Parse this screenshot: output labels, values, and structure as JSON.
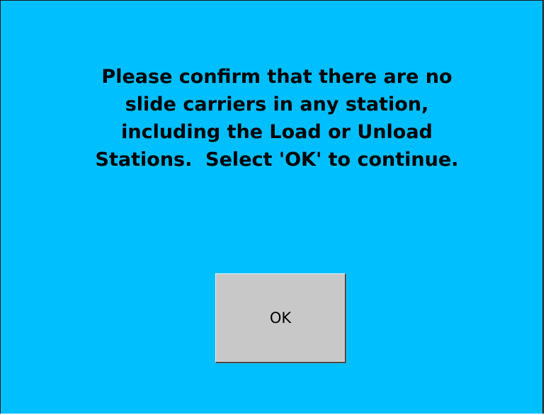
{
  "dialog": {
    "message_lines": [
      "Please confirm that there are no",
      "slide carriers in any station,",
      "including the Load or Unload",
      "Stations.  Select 'OK' to continue."
    ],
    "ok_label": "OK"
  },
  "colors": {
    "background": "#00bfff",
    "button_face": "#c8c8c8",
    "text": "#000000"
  }
}
